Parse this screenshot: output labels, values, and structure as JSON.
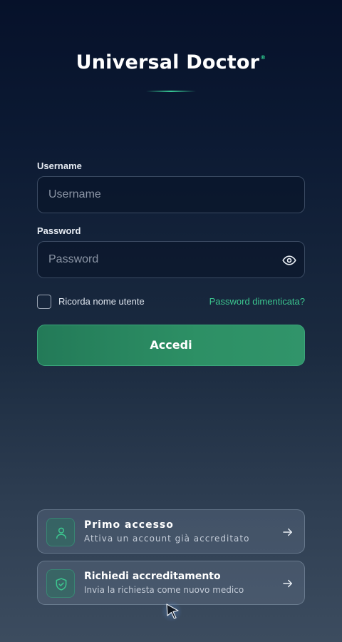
{
  "app": {
    "title": "Universal Doctor",
    "trademark": "®"
  },
  "form": {
    "username_label": "Username",
    "username_placeholder": "Username",
    "username_value": "",
    "password_label": "Password",
    "password_placeholder": "Password",
    "password_value": "",
    "password_toggle_icon": "eye-icon",
    "remember_label": "Ricorda nome utente",
    "remember_checked": false,
    "forgot_link": "Password dimenticata?",
    "submit_label": "Accedi"
  },
  "cards": [
    {
      "title": "Primo accesso",
      "subtitle": "Attiva un account già accreditato",
      "icon": "user-icon",
      "arrow_icon": "arrow-right-icon"
    },
    {
      "title": "Richiedi accreditamento",
      "subtitle": "Invia la richiesta come nuovo medico",
      "icon": "shield-check-icon",
      "arrow_icon": "arrow-right-icon"
    }
  ],
  "colors": {
    "accent": "#3cc68f",
    "button": "#2d9065",
    "background_top": "#06112a",
    "background_bottom": "#3c4c5f"
  }
}
